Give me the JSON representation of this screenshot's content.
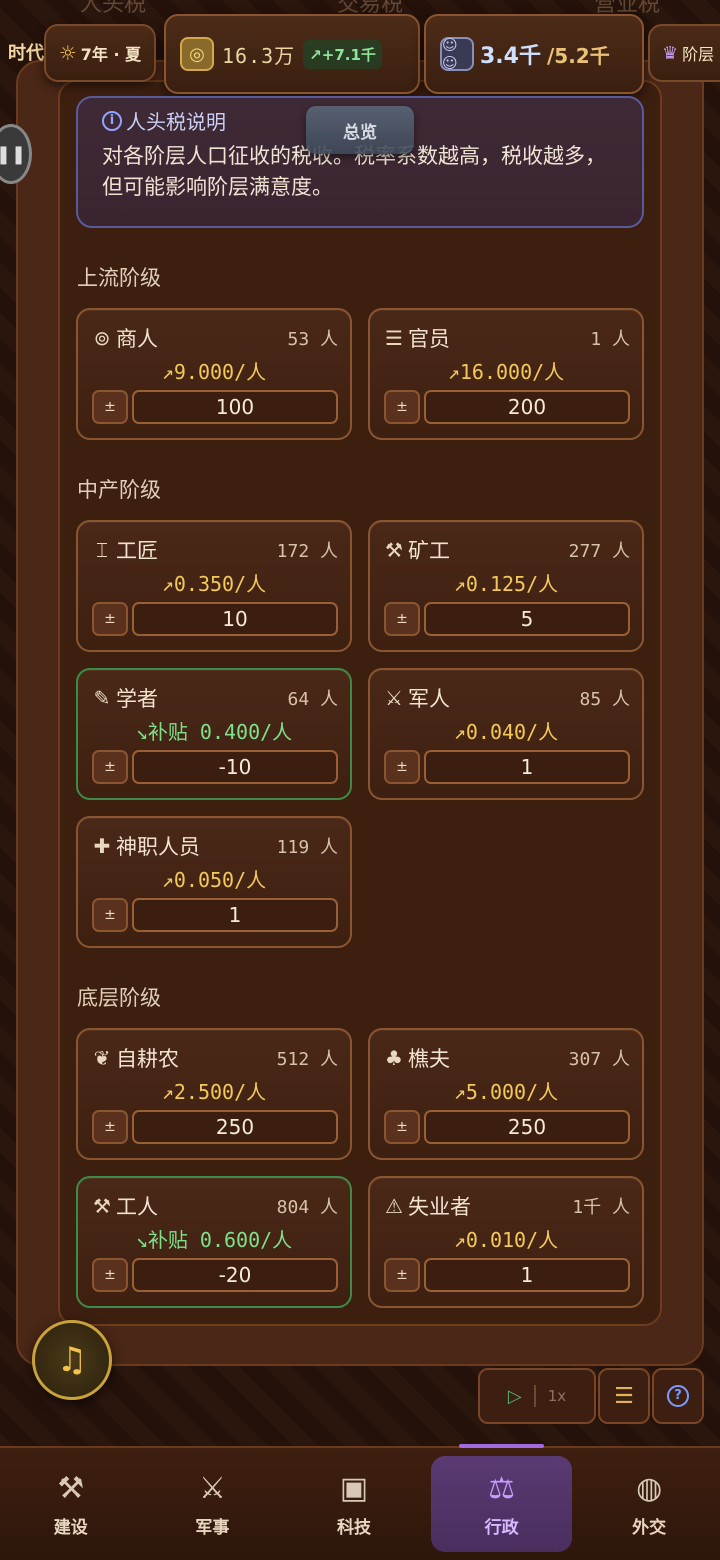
{
  "tabs": [
    "人头税",
    "交易税",
    "营业税"
  ],
  "topbar": {
    "era": "时代",
    "season": "7年 · 夏",
    "money": "16.3万",
    "money_delta": "+7.1千",
    "pop_current": "3.4千",
    "pop_max": "/5.2千",
    "stratum": "阶层"
  },
  "info": {
    "title": "人头税说明",
    "text": "对各阶层人口征收的税收。税率系数越高，税收越多，但可能影响阶层满意度。",
    "tooltip": "总览"
  },
  "sections": {
    "upper": "上流阶级",
    "middle": "中产阶级",
    "lower": "底层阶级"
  },
  "cards": {
    "merchant": {
      "name": "商人",
      "count": "53 人",
      "rate": "9.000/人",
      "value": "100",
      "icon": "coins-icon"
    },
    "official": {
      "name": "官员",
      "count": "1 人",
      "rate": "16.000/人",
      "value": "200",
      "icon": "scroll-icon"
    },
    "artisan": {
      "name": "工匠",
      "count": "172 人",
      "rate": "0.350/人",
      "value": "10",
      "icon": "anvil-icon"
    },
    "miner": {
      "name": "矿工",
      "count": "277 人",
      "rate": "0.125/人",
      "value": "5",
      "icon": "pickaxe-icon"
    },
    "scholar": {
      "name": "学者",
      "count": "64 人",
      "rate": "补贴 0.400/人",
      "value": "-10",
      "icon": "feather-icon"
    },
    "soldier": {
      "name": "军人",
      "count": "85 人",
      "rate": "0.040/人",
      "value": "1",
      "icon": "swords-icon"
    },
    "cleric": {
      "name": "神职人员",
      "count": "119 人",
      "rate": "0.050/人",
      "value": "1",
      "icon": "cross-icon"
    },
    "farmer": {
      "name": "自耕农",
      "count": "512 人",
      "rate": "2.500/人",
      "value": "250",
      "icon": "wheat-icon"
    },
    "woodcutter": {
      "name": "樵夫",
      "count": "307 人",
      "rate": "5.000/人",
      "value": "250",
      "icon": "tree-icon"
    },
    "worker": {
      "name": "工人",
      "count": "804 人",
      "rate": "补贴 0.600/人",
      "value": "-20",
      "icon": "hammer-icon"
    },
    "unemployed": {
      "name": "失业者",
      "count": "1千 人",
      "rate": "0.010/人",
      "value": "1",
      "icon": "warning-icon"
    }
  },
  "controls": {
    "pm_label": "±",
    "speed": "1x"
  },
  "nav": [
    {
      "label": "建设",
      "icon": "hammer-icon"
    },
    {
      "label": "军事",
      "icon": "swords-icon"
    },
    {
      "label": "科技",
      "icon": "chip-icon"
    },
    {
      "label": "行政",
      "icon": "gavel-icon"
    },
    {
      "label": "外交",
      "icon": "globe-icon"
    }
  ],
  "colors": {
    "accent_gold": "#f3c95a",
    "subsidy_green": "#7fe08a",
    "active_purple": "#c89cff"
  }
}
